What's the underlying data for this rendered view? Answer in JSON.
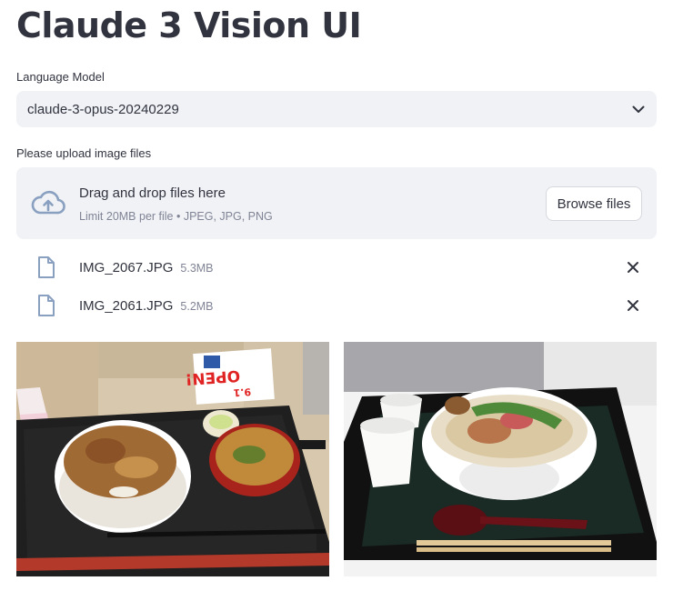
{
  "app": {
    "title": "Claude 3 Vision UI"
  },
  "model_select": {
    "label": "Language Model",
    "value": "claude-3-opus-20240229",
    "icon": "chevron-down-icon"
  },
  "uploader": {
    "label": "Please upload image files",
    "title": "Drag and drop files here",
    "hint": "Limit 20MB per file • JPEG, JPG, PNG",
    "browse_label": "Browse files",
    "icon": "cloud-upload-icon"
  },
  "files": [
    {
      "name": "IMG_2067.JPG",
      "size": "5.3MB"
    },
    {
      "name": "IMG_2061.JPG",
      "size": "5.2MB"
    }
  ],
  "images": [
    {
      "alt": "gyudon-set-photo"
    },
    {
      "alt": "ramen-bowl-photo"
    }
  ],
  "photo_text": {
    "sign_open": "OPEN!",
    "sign_date": "9.1"
  },
  "colors": {
    "accent_text": "#31333f",
    "muted_text": "#808495",
    "panel_bg": "#f0f2f6",
    "icon_blue": "#8aa0c0"
  }
}
